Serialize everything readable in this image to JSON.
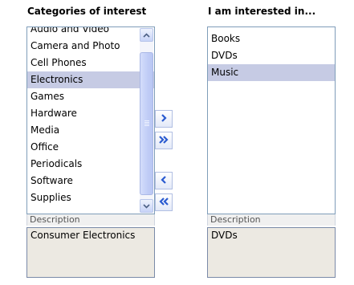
{
  "categories": {
    "header": "Categories of interest",
    "items": [
      "Audio and Video",
      "Camera and Photo",
      "Cell Phones",
      "Electronics",
      "Games",
      "Hardware",
      "Media",
      "Office",
      "Periodicals",
      "Software",
      "Supplies"
    ],
    "selected": "Electronics",
    "description_label": "Description",
    "description_value": "Consumer Electronics"
  },
  "interested": {
    "header": "I am interested in...",
    "items": [
      "Books",
      "DVDs",
      "Music"
    ],
    "selected": "Music",
    "description_label": "Description",
    "description_value": "DVDs"
  },
  "buttons": {
    "move_right": "chevron-right-icon",
    "move_all_right": "double-chevron-right-icon",
    "move_left": "chevron-left-icon",
    "move_all_left": "double-chevron-left-icon"
  },
  "colors": {
    "selection": "#c6cbe4",
    "arrow": "#2a5bd0",
    "border": "#7f9db9"
  }
}
